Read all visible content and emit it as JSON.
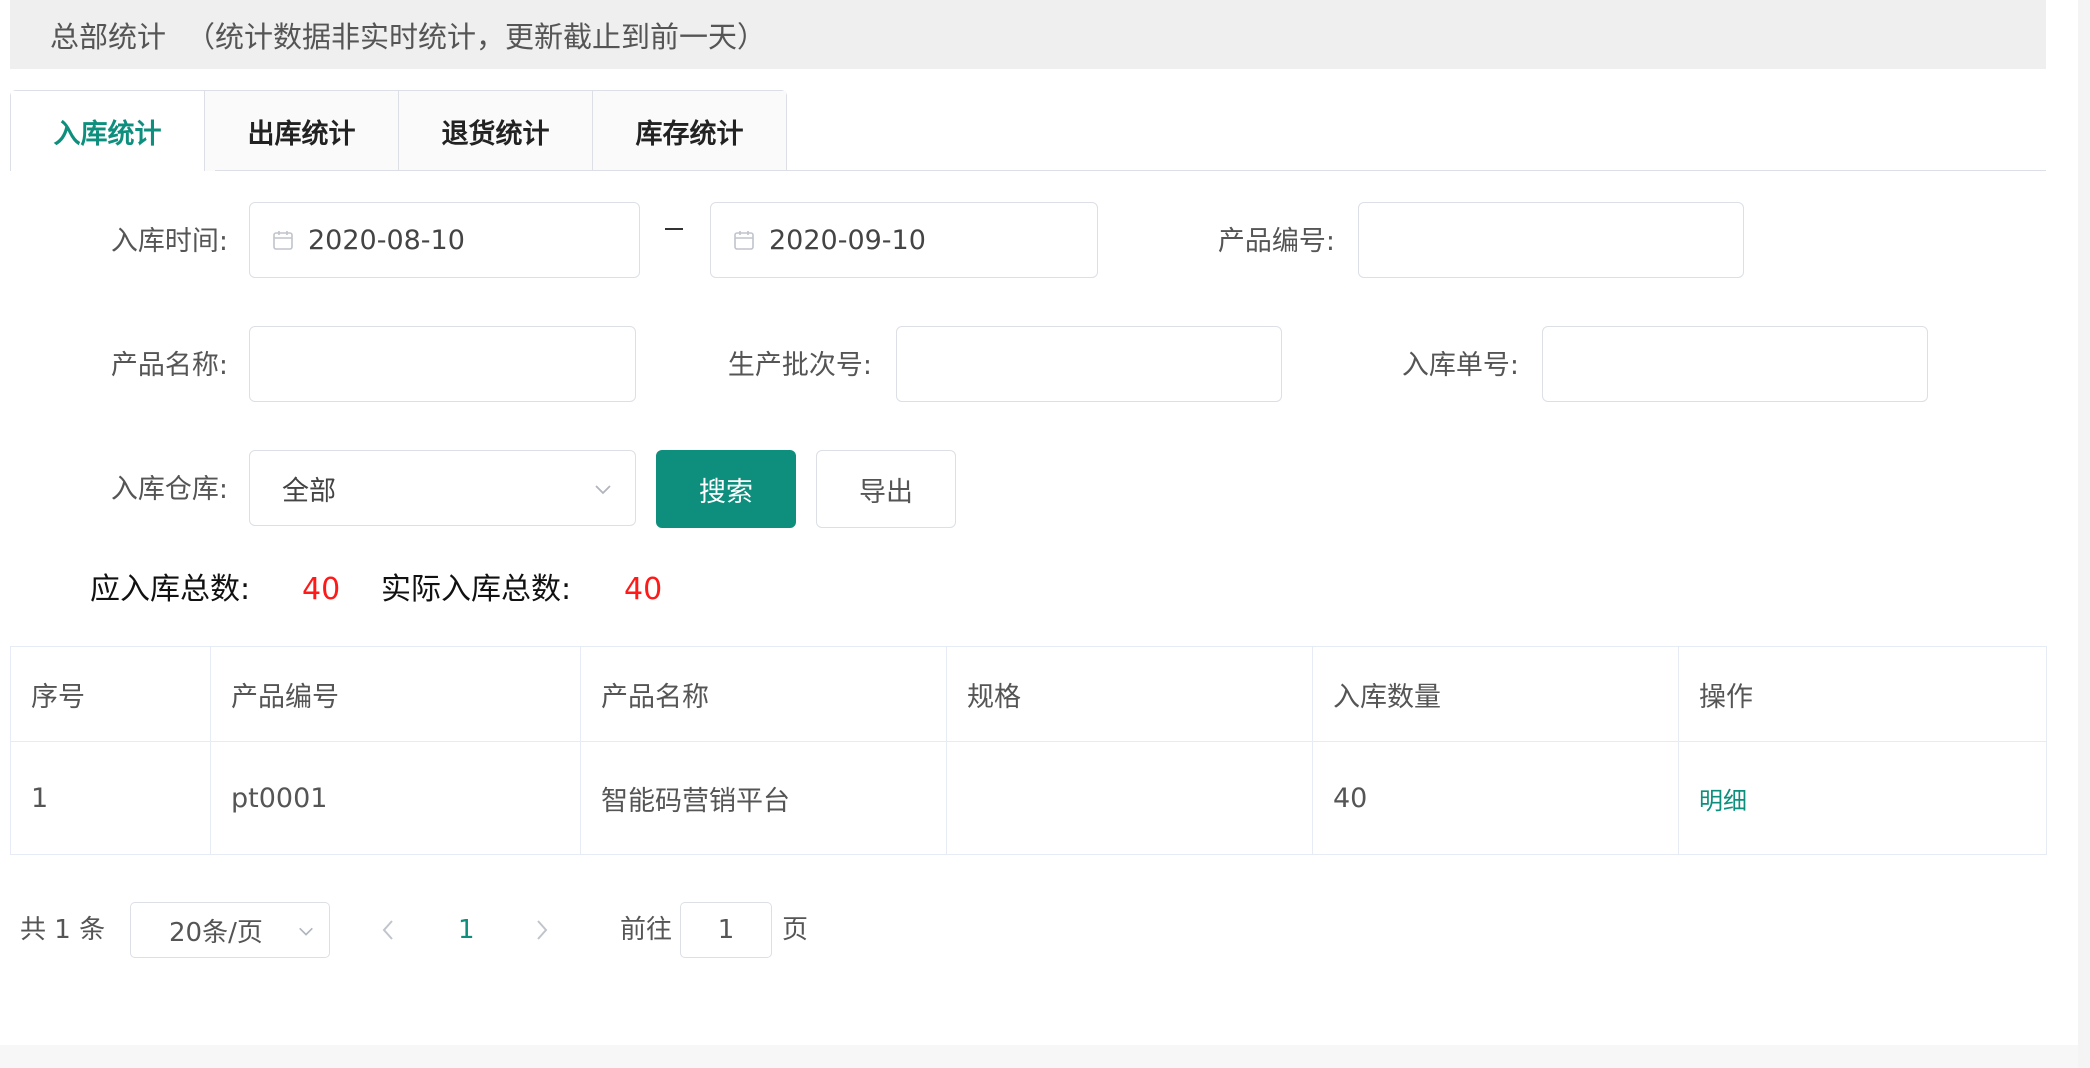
{
  "header": {
    "title": "总部统计",
    "note": "（统计数据非实时统计，更新截止到前一天）"
  },
  "tabs": [
    {
      "label": "入库统计",
      "active": true
    },
    {
      "label": "出库统计",
      "active": false
    },
    {
      "label": "退货统计",
      "active": false
    },
    {
      "label": "库存统计",
      "active": false
    }
  ],
  "filters": {
    "time_label": "入库时间:",
    "date_start": "2020-08-10",
    "date_end": "2020-09-10",
    "date_separator": "–",
    "product_code_label": "产品编号:",
    "product_code_value": "",
    "product_name_label": "产品名称:",
    "product_name_value": "",
    "batch_label": "生产批次号:",
    "batch_value": "",
    "order_label": "入库单号:",
    "order_value": "",
    "warehouse_label": "入库仓库:",
    "warehouse_value": "全部",
    "search_button": "搜索",
    "export_button": "导出"
  },
  "summary": {
    "expected_label": "应入库总数:",
    "expected_value": "40",
    "actual_label": "实际入库总数:",
    "actual_value": "40"
  },
  "table": {
    "columns": [
      "序号",
      "产品编号",
      "产品名称",
      "规格",
      "入库数量",
      "操作"
    ],
    "rows": [
      {
        "index": "1",
        "code": "pt0001",
        "name": "智能码营销平台",
        "spec": "",
        "qty": "40",
        "action": "明细"
      }
    ]
  },
  "pagination": {
    "total": "共 1 条",
    "page_size": "20条/页",
    "current_page": "1",
    "goto_label": "前往",
    "goto_value": "1",
    "page_suffix": "页"
  },
  "colors": {
    "accent": "#0e8f7e",
    "highlight": "#ff1a1a"
  },
  "icons": {
    "date_icon": "calendar-icon",
    "dropdown_icon": "chevron-down-icon",
    "prev_icon": "chevron-left-icon",
    "next_icon": "chevron-right-icon"
  }
}
